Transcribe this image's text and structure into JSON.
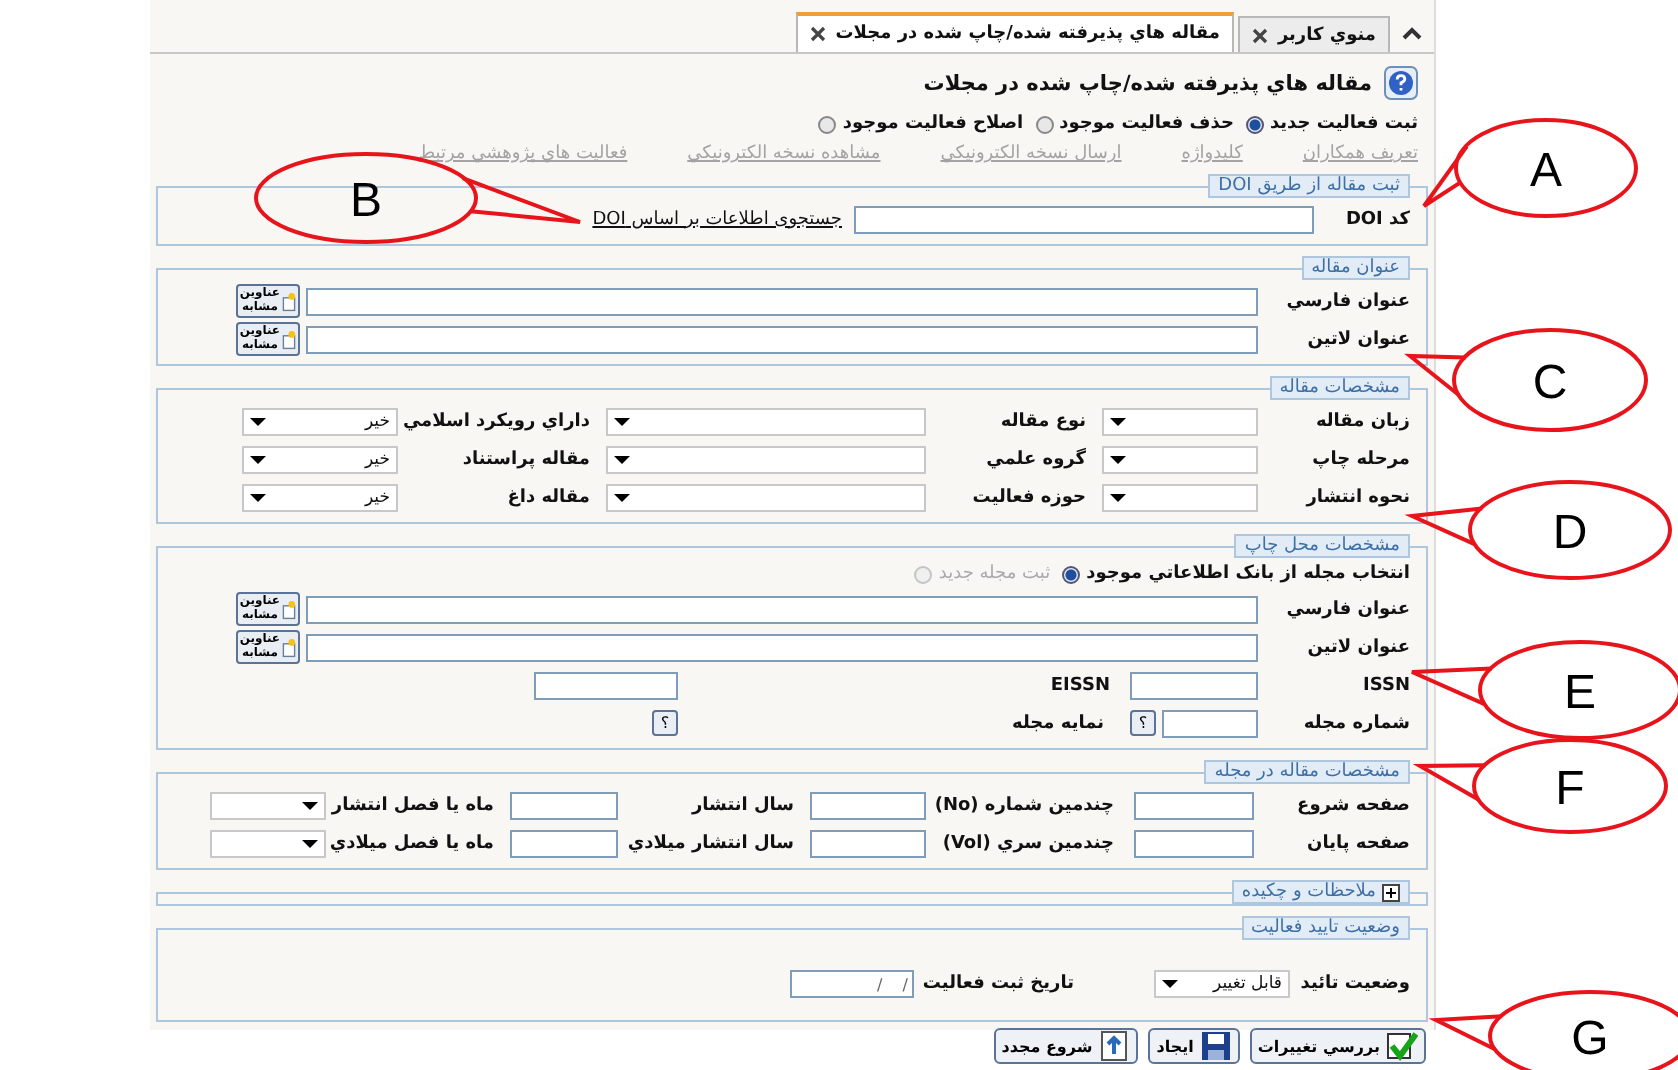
{
  "tabs": [
    {
      "label": "منوي کاربر",
      "selected": false
    },
    {
      "label": "مقاله هاي پذيرفته شده/چاپ شده در مجلات",
      "selected": true
    }
  ],
  "page_title": "مقاله هاي پذيرفته شده/چاپ شده در مجلات",
  "mode_options": [
    {
      "label": "ثبت فعاليت جديد",
      "selected": true
    },
    {
      "label": "حذف فعاليت موجود",
      "selected": false
    },
    {
      "label": "اصلاح فعاليت موجود",
      "selected": false
    }
  ],
  "links": [
    {
      "label": "تعريف همکاران",
      "disabled": true
    },
    {
      "label": "کليدواژه",
      "disabled": true
    },
    {
      "label": "ارسال نسخه الکترونيکي",
      "disabled": true
    },
    {
      "label": "مشاهده نسخه الکترونيکي",
      "disabled": true
    },
    {
      "label": "فعاليت هاي پژوهشي مرتبط",
      "disabled": true
    }
  ],
  "doi_section": {
    "legend": "ثبت مقاله از طريق DOI",
    "code_label": "کد DOI",
    "search_link": "جستجوی اطلاعات بر اساس DOI"
  },
  "title_section": {
    "legend": "عنوان مقاله",
    "rows": [
      {
        "label": "عنوان فارسي",
        "similar_button": "عناوين مشابه"
      },
      {
        "label": "عنوان لاتين",
        "similar_button": "عناوين مشابه"
      }
    ]
  },
  "article_section": {
    "legend": "مشخصات مقاله",
    "rows": [
      [
        {
          "label": "زبان مقاله"
        },
        {
          "label": "نوع مقاله"
        },
        {
          "label": "داراي رويکرد اسلامي",
          "value": "خير"
        }
      ],
      [
        {
          "label": "مرحله چاپ"
        },
        {
          "label": "گروه علمي"
        },
        {
          "label": "مقاله پراستناد",
          "value": "خير"
        }
      ],
      [
        {
          "label": "نحوه انتشار"
        },
        {
          "label": "حوزه فعاليت"
        },
        {
          "label": "مقاله داغ",
          "value": "خير"
        }
      ]
    ]
  },
  "print_section": {
    "legend": "مشخصات محل چاپ",
    "source_options": [
      {
        "label": "انتخاب مجله از بانک اطلاعاتي موجود",
        "selected": true,
        "disabled": false
      },
      {
        "label": "ثبت مجله جديد",
        "selected": false,
        "disabled": true
      }
    ],
    "rows": [
      {
        "label": "عنوان فارسي",
        "similar_button": "عناوين مشابه"
      },
      {
        "label": "عنوان لاتين",
        "similar_button": "عناوين مشابه"
      }
    ],
    "issn_label": "ISSN",
    "eissn_label": "EISSN",
    "journal_number_label": "شماره مجله",
    "journal_index_label": "نمايه مجله",
    "help_button": "؟"
  },
  "journal_section": {
    "legend": "مشخصات مقاله در مجله",
    "rows": [
      [
        {
          "label": "صفحه شروع",
          "kind": "text"
        },
        {
          "label": "چندمين شماره (No)",
          "kind": "text"
        },
        {
          "label": "سال انتشار",
          "kind": "text"
        },
        {
          "label": "ماه يا فصل انتشار",
          "kind": "select"
        }
      ],
      [
        {
          "label": "صفحه پايان",
          "kind": "text"
        },
        {
          "label": "چندمين سري (Vol)",
          "kind": "text"
        },
        {
          "label": "سال انتشار ميلادي",
          "kind": "text"
        },
        {
          "label": "ماه يا فصل ميلادي",
          "kind": "select"
        }
      ]
    ]
  },
  "notes_section": {
    "legend": "ملاحظات و چکيده",
    "expanded": false
  },
  "approval_section": {
    "legend": "وضعيت تاييد فعاليت",
    "status_label": "وضعيت تائيد",
    "status_value": "قابل تغيير",
    "date_label": "تاريخ ثبت فعاليت",
    "date_value": "/    /"
  },
  "buttons": [
    {
      "label": "بررسي تغييرات",
      "kind": "check"
    },
    {
      "label": "ايجاد",
      "kind": "save"
    },
    {
      "label": "شروع مجدد",
      "kind": "restart"
    }
  ],
  "callouts": [
    {
      "label": "A"
    },
    {
      "label": "B"
    },
    {
      "label": "C"
    },
    {
      "label": "D"
    },
    {
      "label": "E"
    },
    {
      "label": "F"
    },
    {
      "label": "G"
    }
  ]
}
